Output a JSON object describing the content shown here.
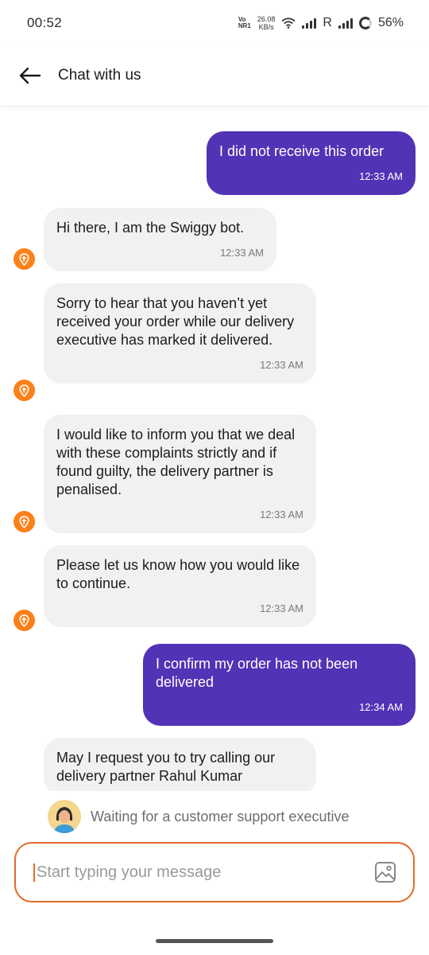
{
  "status_bar": {
    "time": "00:52",
    "network_top": "Vo",
    "network_bottom": "NR1",
    "speed_value": "26.08",
    "speed_unit": "KB/s",
    "sim2_label": "R",
    "battery": "56%"
  },
  "header": {
    "title": "Chat with us",
    "back_icon": "arrow-left-icon"
  },
  "messages": [
    {
      "sender": "user",
      "text": "I did not receive this order",
      "time": "12:33 AM"
    },
    {
      "sender": "bot",
      "text": "Hi there, I am the Swiggy bot.",
      "time": "12:33 AM"
    },
    {
      "sender": "bot",
      "text": "Sorry to hear that you haven’t yet received your order while our delivery executive has marked it delivered.",
      "time": "12:33 AM"
    },
    {
      "sender": "bot",
      "text": "I would like to inform you that we deal with these complaints strictly and if found guilty, the delivery partner is penalised.",
      "time": "12:33 AM"
    },
    {
      "sender": "bot",
      "text": "Please let us know how you would like to continue.",
      "time": "12:33 AM"
    },
    {
      "sender": "user",
      "text": "I confirm my order has not been delivered",
      "time": "12:34 AM"
    },
    {
      "sender": "bot",
      "text": "May I request you to try calling our delivery partner Rahul Kumar",
      "time": ""
    }
  ],
  "waiting": {
    "text": "Waiting for a customer support executive"
  },
  "composer": {
    "placeholder": "Start typing your message",
    "attach_icon": "image-icon"
  },
  "colors": {
    "user_bubble": "#5232b5",
    "bot_bubble": "#f1f1f4",
    "accent": "#fc8019",
    "input_border": "#e36a2a"
  }
}
